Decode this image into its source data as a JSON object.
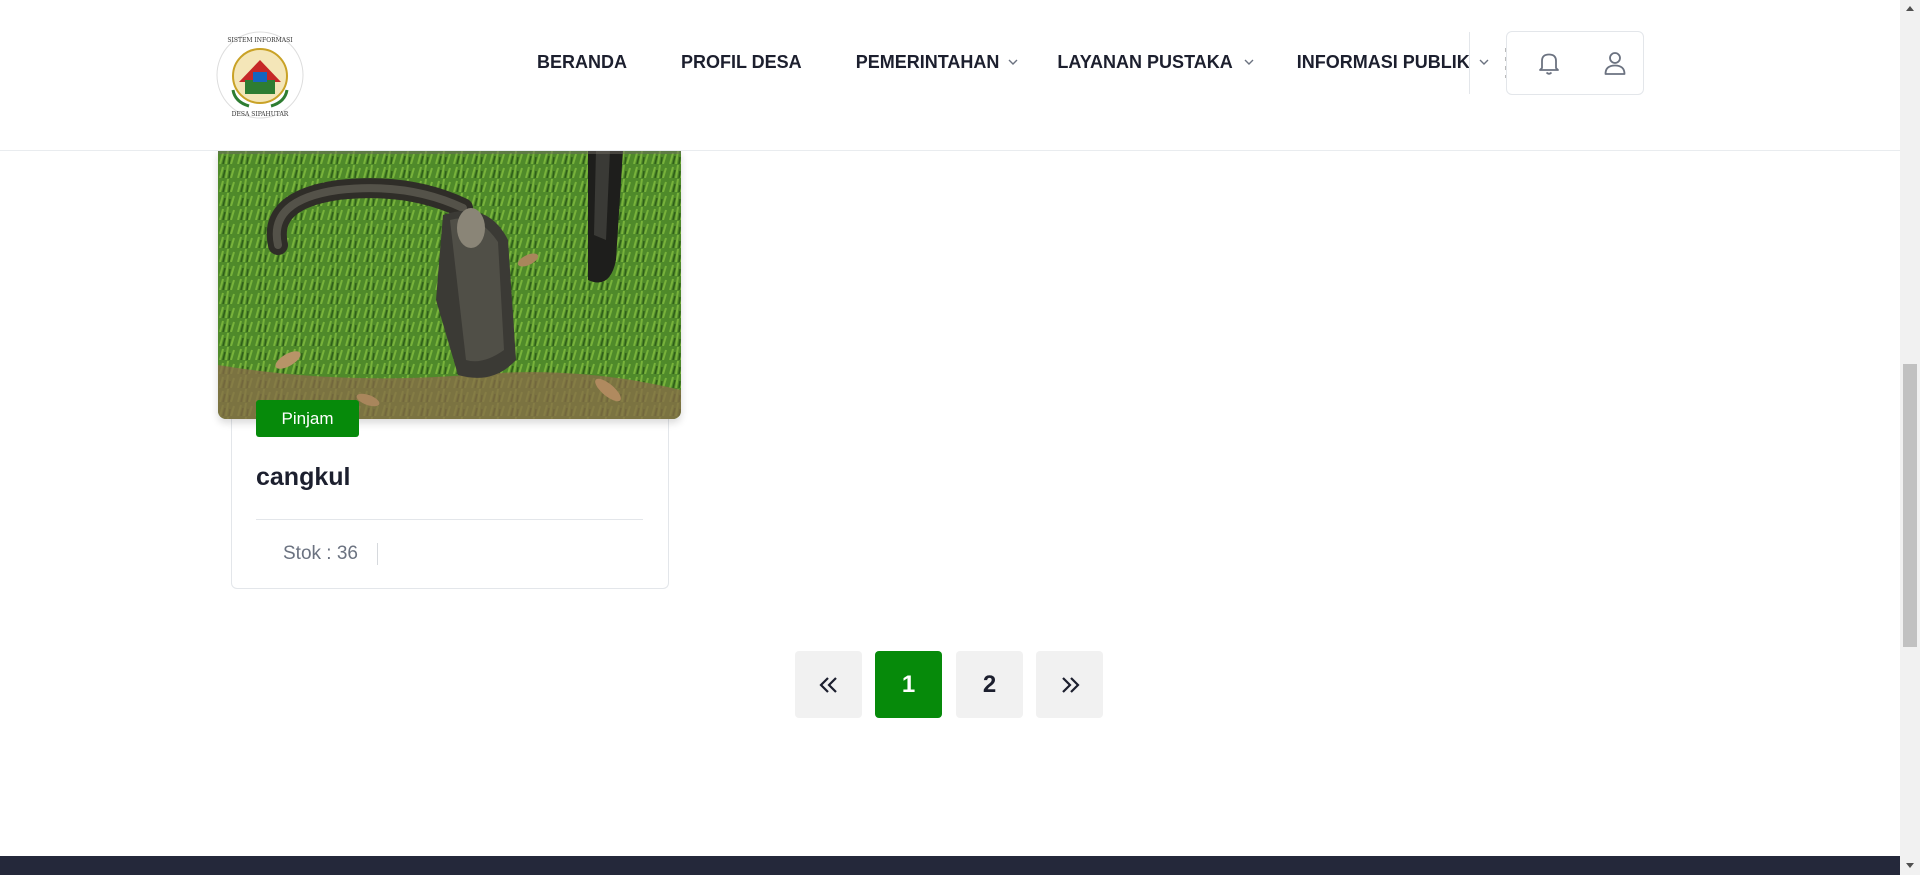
{
  "header": {
    "logo_alt": "Sistem Informasi Desa Sipahutar",
    "logo_text_top": "SISTEM INFORMASI",
    "logo_text_bottom": "DESA SIPAHUTAR",
    "nav": [
      {
        "label": "BERANDA",
        "has_dropdown": false
      },
      {
        "label": "PROFIL DESA",
        "has_dropdown": false
      },
      {
        "label": "PEMERINTAHAN",
        "has_dropdown": true
      },
      {
        "label": "LAYANAN PUSTAKA",
        "has_dropdown": true
      },
      {
        "label": "INFORMASI PUBLIK",
        "has_dropdown": true
      }
    ],
    "icons": [
      "bell-icon",
      "user-icon"
    ]
  },
  "card": {
    "badge": "Pinjam",
    "title": "cangkul",
    "stock": "Stok : 36"
  },
  "pagination": {
    "prev": "«",
    "pages": [
      "1",
      "2"
    ],
    "current": "1",
    "next": "»"
  },
  "colors": {
    "accent": "#068a0a",
    "text": "#1c1f2e",
    "footer": "#24283a"
  }
}
